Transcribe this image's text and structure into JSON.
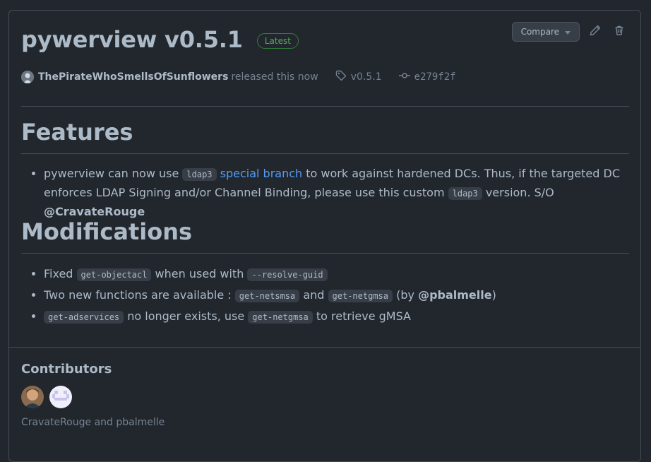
{
  "release": {
    "title": "pywerview v0.5.1",
    "badge": "Latest",
    "author": "ThePirateWhoSmellsOfSunflowers",
    "released_text": "released this now",
    "tag": "v0.5.1",
    "commit": "e279f2f"
  },
  "actions": {
    "compare_label": "Compare",
    "edit_icon": "pencil-icon",
    "delete_icon": "trash-icon"
  },
  "features": {
    "heading": "Features",
    "item1": {
      "t1": "pywerview can now use ",
      "code1": "ldap3",
      "link": "special branch",
      "t2": " to work against hardened DCs. Thus, if the targeted DC enforces LDAP Signing and/or Channel Binding, please use this custom ",
      "code2": "ldap3",
      "t3": " version. S/O ",
      "mention": "@CravateRouge"
    }
  },
  "modifications": {
    "heading": "Modifications",
    "item1": {
      "t1": "Fixed ",
      "code1": "get-objectacl",
      "t2": " when used with ",
      "code2": "--resolve-guid"
    },
    "item2": {
      "t1": "Two new functions are available : ",
      "code1": "get-netsmsa",
      "t2": " and ",
      "code2": "get-netgmsa",
      "t3": " (by ",
      "mention": "@pbalmelle",
      "t4": ")"
    },
    "item3": {
      "code1": "get-adservices",
      "t1": " no longer exists, use ",
      "code2": "get-netgmsa",
      "t2": " to retrieve gMSA"
    }
  },
  "contributors": {
    "title": "Contributors",
    "names": "CravateRouge and pbalmelle"
  },
  "colors": {
    "background": "#22272e",
    "border": "#444c56",
    "text": "#adbac7",
    "muted": "#768390",
    "link": "#539bf5",
    "badge_green": "#57ab5a"
  }
}
